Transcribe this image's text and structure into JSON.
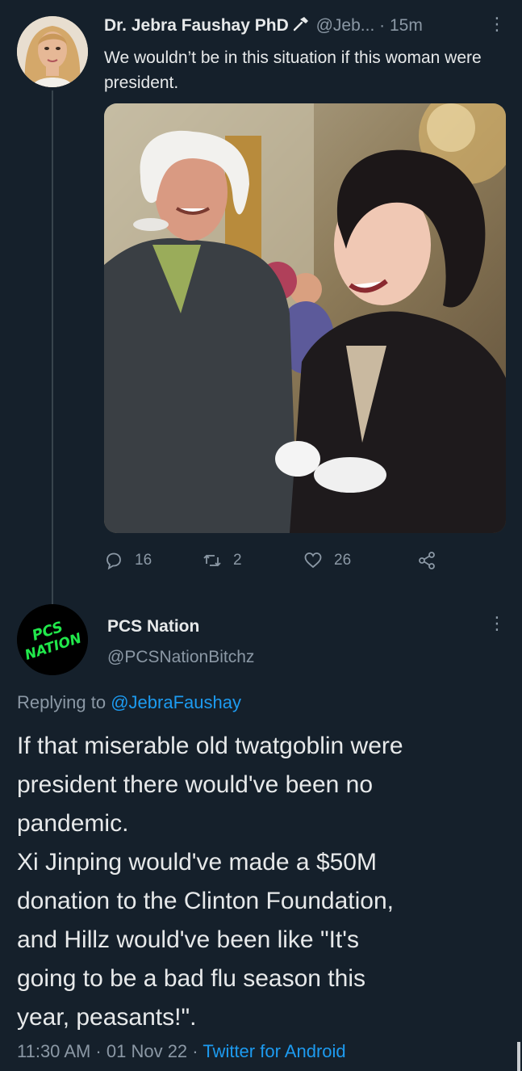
{
  "tweet1": {
    "author_name": "Dr. Jebra Faushay PhD",
    "badge_icon": "hammer-icon",
    "handle": "@Jeb...",
    "time": "· 15m",
    "text": "We wouldn’t be in this situation if this woman were president.",
    "media_icon": "photo-costumed-couple",
    "actions": {
      "replies": "16",
      "retweets": "2",
      "likes": "26"
    }
  },
  "tweet2": {
    "author_name": "PCS Nation",
    "handle": "@PCSNationBitchz",
    "avatar_text": "PCS NATION",
    "replying_label": "Replying to",
    "replying_handle": "@JebraFaushay",
    "text": "If that miserable old twatgoblin were\npresident there would've been no\npandemic.\nXi Jinping would've made a $50M\ndonation to the Clinton Foundation,\nand Hillz would've been like \"It's\ngoing to be a bad flu season this\nyear, peasants!\".",
    "time": "11:30 AM · 01 Nov 22 ·",
    "source": "Twitter for Android"
  },
  "colors": {
    "background": "#15202b",
    "text": "#e7e9ea",
    "muted": "#8b98a5",
    "link": "#1d9bf0",
    "avatar_logo": "#21e84b"
  }
}
